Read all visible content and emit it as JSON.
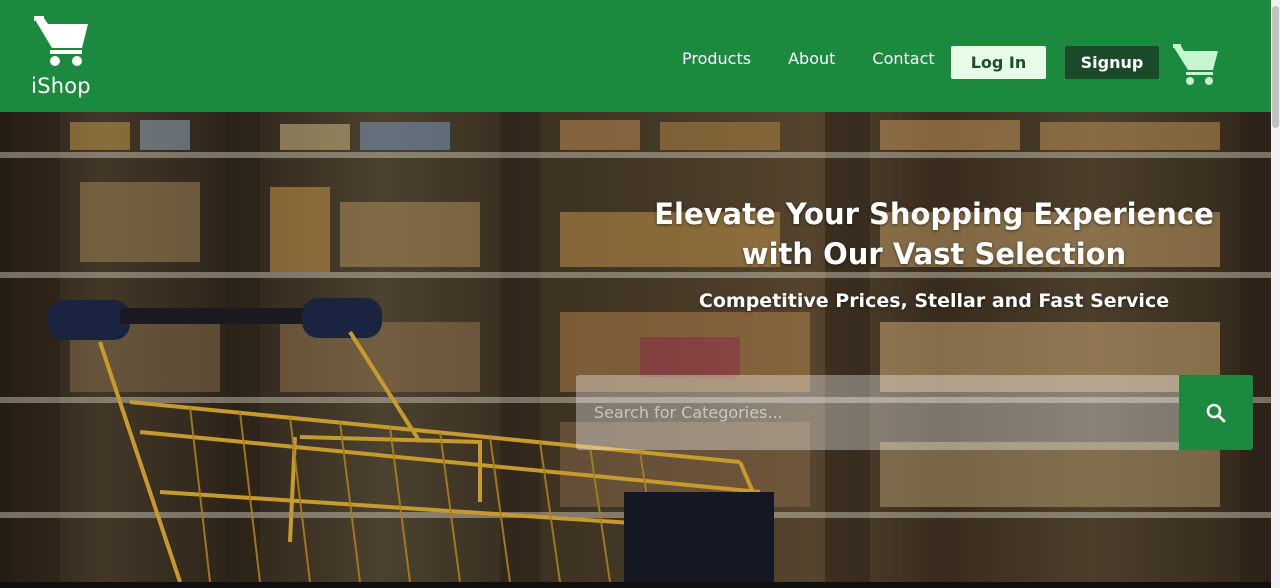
{
  "brand": {
    "name": "iShop",
    "logo_icon": "shopping-cart-icon"
  },
  "nav": {
    "links": [
      "Products",
      "About",
      "Contact"
    ],
    "login_label": "Log In",
    "signup_label": "Signup",
    "cart_icon": "shopping-cart-icon"
  },
  "hero": {
    "title_line1": "Elevate Your Shopping Experience",
    "title_line2": "with Our Vast Selection",
    "subtitle": "Competitive Prices, Stellar and Fast Service",
    "search_placeholder": "Search for Categories...",
    "search_value": "",
    "search_icon": "search-icon"
  },
  "colors": {
    "primary_green": "#1c8a3e",
    "login_bg": "#e8fbe9",
    "signup_bg": "#1b4a2a",
    "cart_icon_color": "#c8f5cf"
  }
}
